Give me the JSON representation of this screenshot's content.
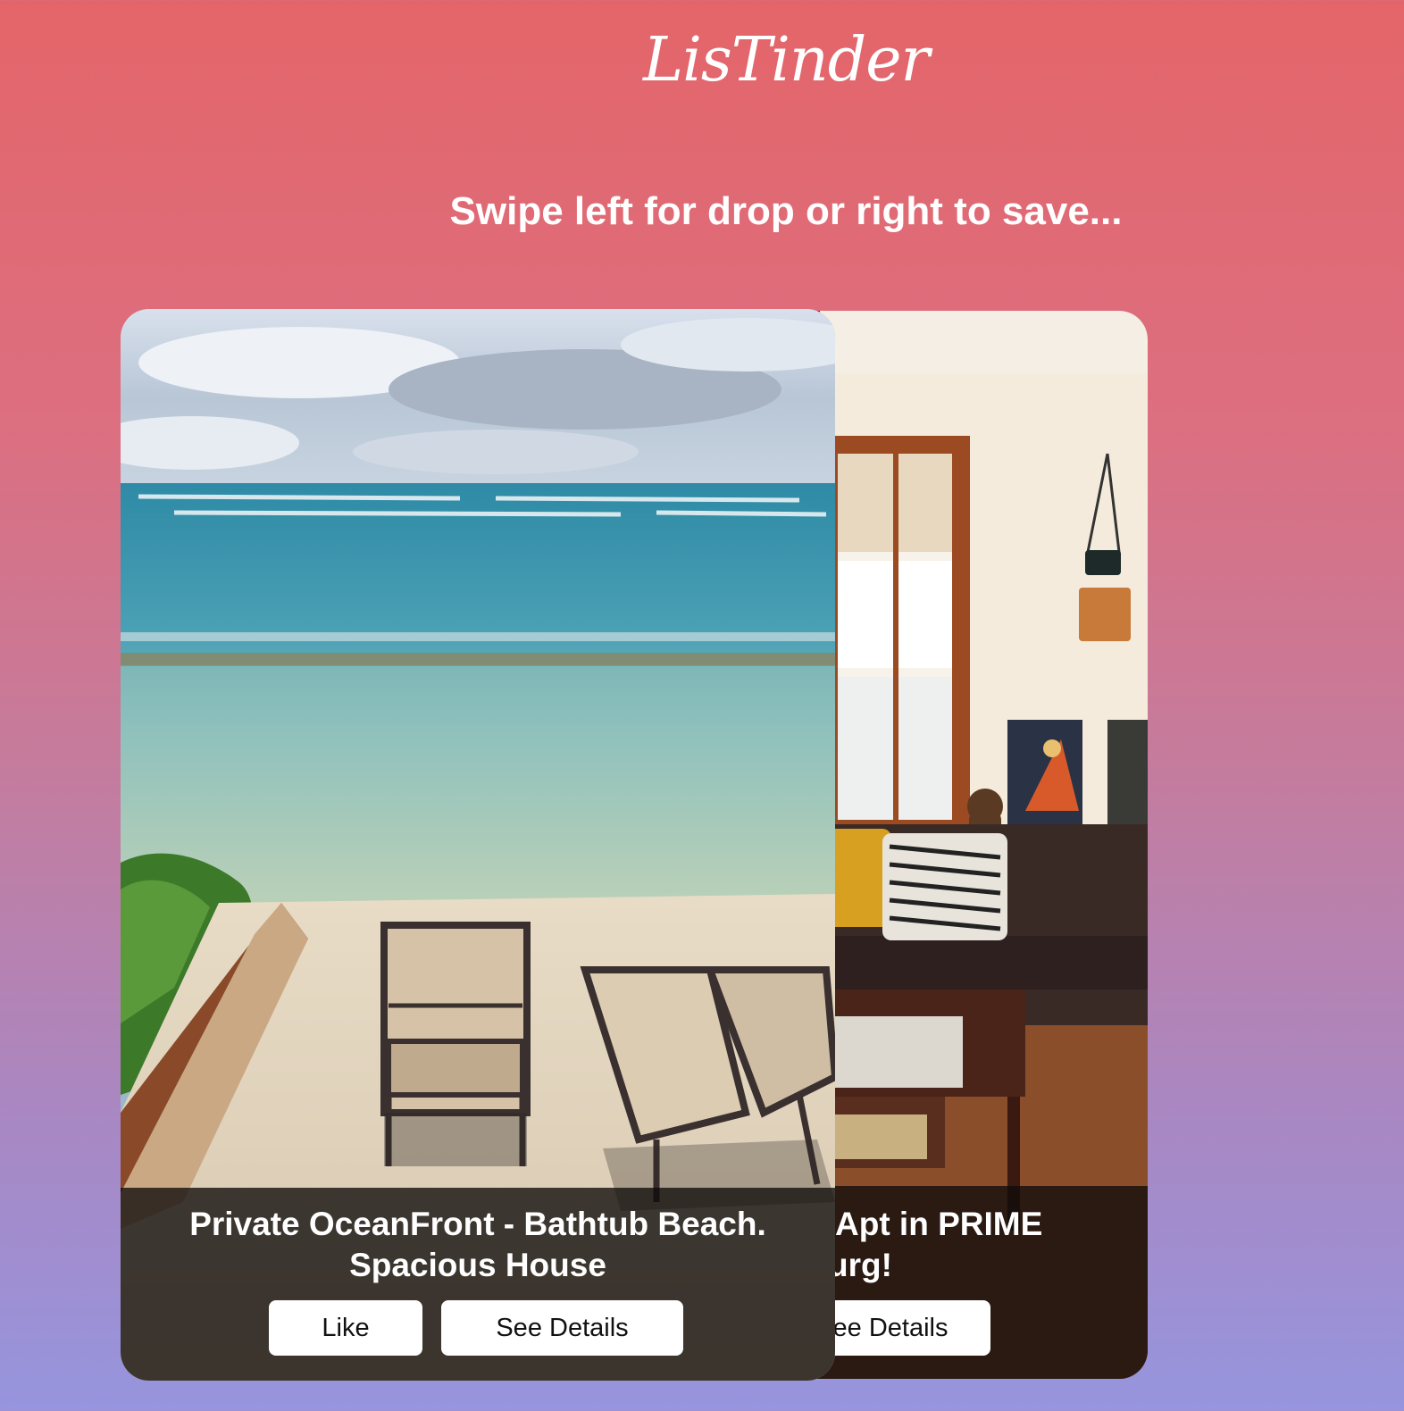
{
  "app": {
    "logo": "LisTinder",
    "instruction": "Swipe left for drop or right to save..."
  },
  "cards": [
    {
      "title": "Private OceanFront - Bathtub Beach. Spacious House",
      "like_label": "Like",
      "details_label": "See Details"
    },
    {
      "title_line1": "Apt in PRIME",
      "title_line2": "urg!",
      "details_label": "ee Details"
    }
  ],
  "colors": {
    "gradient_top": "#e46569",
    "gradient_bottom": "#9695de",
    "overlay": "#0f0c0a",
    "button_bg": "#ffffff"
  }
}
